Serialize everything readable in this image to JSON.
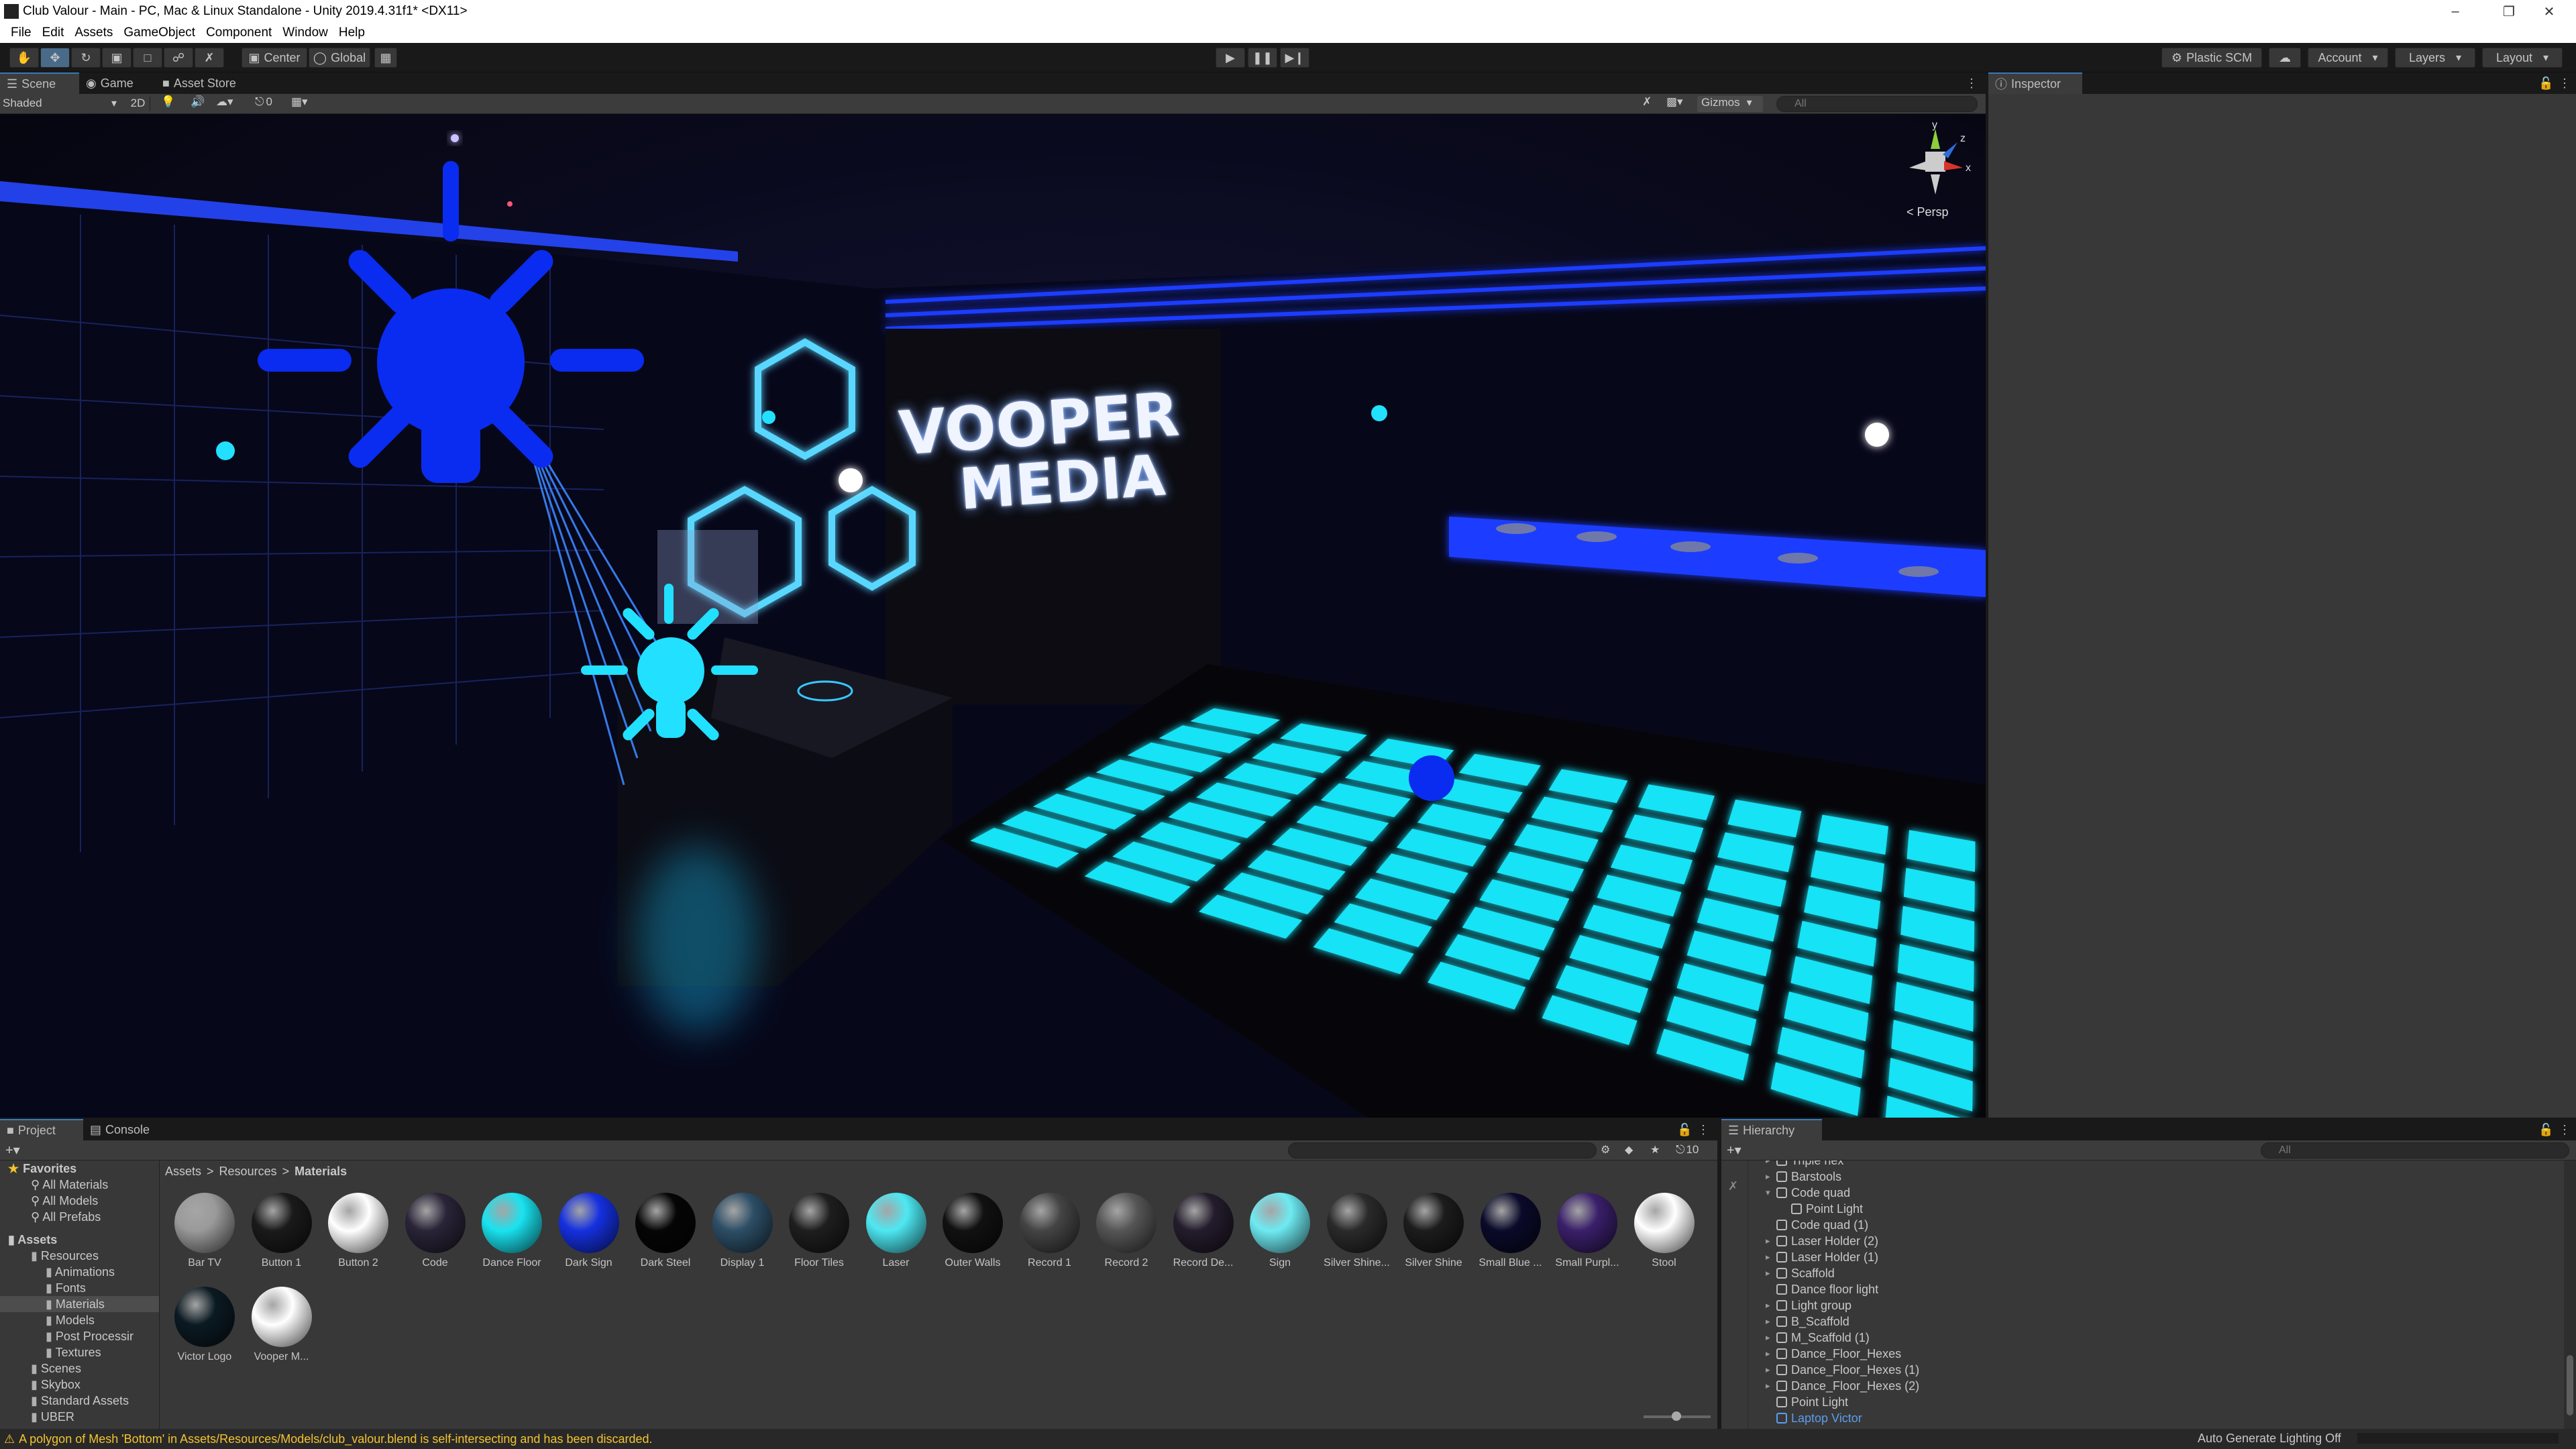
{
  "window": {
    "title": "Club Valour - Main - PC, Mac & Linux Standalone - Unity 2019.4.31f1* <DX11>"
  },
  "menu": [
    "File",
    "Edit",
    "Assets",
    "GameObject",
    "Component",
    "Window",
    "Help"
  ],
  "toolbar": {
    "pivot_label": "Center",
    "space_label": "Global",
    "plastic_label": "Plastic SCM",
    "account_label": "Account",
    "layers_label": "Layers",
    "layout_label": "Layout"
  },
  "scene_tabs": [
    "Scene",
    "Game",
    "Asset Store"
  ],
  "scene_bar": {
    "shading": "Shaded",
    "mode_2d": "2D",
    "hidden_count": "0",
    "gizmos_label": "Gizmos",
    "search_placeholder": "All"
  },
  "scene": {
    "sign_line1": "VOOPER",
    "sign_line2": "MEDIA",
    "persp_label": "< Persp",
    "axis_y": "y",
    "axis_x": "x",
    "axis_z": "z"
  },
  "inspector": {
    "tab_label": "Inspector"
  },
  "project": {
    "tabs": [
      "Project",
      "Console"
    ],
    "breadcrumb": [
      "Assets",
      "Resources",
      "Materials"
    ],
    "visible_count": "10",
    "favorites_label": "Favorites",
    "favorites": [
      "All Materials",
      "All Models",
      "All Prefabs"
    ],
    "assets_label": "Assets",
    "folders": [
      {
        "label": "Resources",
        "depth": 1
      },
      {
        "label": "Animations",
        "depth": 2
      },
      {
        "label": "Fonts",
        "depth": 2
      },
      {
        "label": "Materials",
        "depth": 2
      },
      {
        "label": "Models",
        "depth": 2
      },
      {
        "label": "Post Processir",
        "depth": 2
      },
      {
        "label": "Textures",
        "depth": 2
      },
      {
        "label": "Scenes",
        "depth": 1
      },
      {
        "label": "Skybox",
        "depth": 1
      },
      {
        "label": "Standard Assets",
        "depth": 1
      },
      {
        "label": "UBER",
        "depth": 1
      }
    ],
    "materials": [
      {
        "label": "Bar TV",
        "color": "#9a9a9a"
      },
      {
        "label": "Button 1",
        "color": "#1a1a1a"
      },
      {
        "label": "Button 2",
        "color": "#ffffff"
      },
      {
        "label": "Code",
        "color": "#2a2438"
      },
      {
        "label": "Dance Floor",
        "color": "#19e3f0"
      },
      {
        "label": "Dark Sign",
        "color": "#1530e0"
      },
      {
        "label": "Dark Steel",
        "color": "#050505"
      },
      {
        "label": "Display 1",
        "color": "#2c4e66"
      },
      {
        "label": "Floor Tiles",
        "color": "#1e1e1e"
      },
      {
        "label": "Laser",
        "color": "#4de8f2"
      },
      {
        "label": "Outer Walls",
        "color": "#111111"
      },
      {
        "label": "Record 1",
        "color": "#444444"
      },
      {
        "label": "Record 2",
        "color": "#555555"
      },
      {
        "label": "Record De...",
        "color": "#241c2c"
      },
      {
        "label": "Sign",
        "color": "#6eeaf2"
      },
      {
        "label": "Silver Shine...",
        "color": "#2a2a2a"
      },
      {
        "label": "Silver Shine",
        "color": "#1c1c1c"
      },
      {
        "label": "Small Blue ...",
        "color": "#0a0a2a"
      },
      {
        "label": "Small Purpl...",
        "color": "#3a1f6a"
      },
      {
        "label": "Stool",
        "color": "#ffffff"
      },
      {
        "label": "Victor Logo",
        "color": "#0b1a22"
      },
      {
        "label": "Vooper M...",
        "color": "#ffffff"
      }
    ]
  },
  "hierarchy": {
    "tab_label": "Hierarchy",
    "search_placeholder": "All",
    "items": [
      {
        "label": "Triple hex",
        "indent": 1,
        "arrow": true
      },
      {
        "label": "Barstools",
        "indent": 1,
        "arrow": true
      },
      {
        "label": "Code quad",
        "indent": 1,
        "arrow": true,
        "open": true
      },
      {
        "label": "Point Light",
        "indent": 2,
        "arrow": false
      },
      {
        "label": "Code quad (1)",
        "indent": 1,
        "arrow": false
      },
      {
        "label": "Laser Holder (2)",
        "indent": 1,
        "arrow": true
      },
      {
        "label": "Laser Holder (1)",
        "indent": 1,
        "arrow": true
      },
      {
        "label": "Scaffold",
        "indent": 1,
        "arrow": true
      },
      {
        "label": "Dance floor light",
        "indent": 1,
        "arrow": false
      },
      {
        "label": "Light group",
        "indent": 1,
        "arrow": true
      },
      {
        "label": "B_Scaffold",
        "indent": 1,
        "arrow": true
      },
      {
        "label": "M_Scaffold (1)",
        "indent": 1,
        "arrow": true
      },
      {
        "label": "Dance_Floor_Hexes",
        "indent": 1,
        "arrow": true
      },
      {
        "label": "Dance_Floor_Hexes (1)",
        "indent": 1,
        "arrow": true
      },
      {
        "label": "Dance_Floor_Hexes (2)",
        "indent": 1,
        "arrow": true
      },
      {
        "label": "Point Light",
        "indent": 1,
        "arrow": false
      },
      {
        "label": "Laptop Victor",
        "indent": 1,
        "arrow": false,
        "highlight": true
      }
    ]
  },
  "status": {
    "message": "A polygon of Mesh 'Bottom' in Assets/Resources/Models/club_valour.blend is self-intersecting and has been discarded.",
    "lighting": "Auto Generate Lighting Off"
  },
  "colors": {
    "accent": "#3a79bb",
    "glow_cyan": "#1ee6f5",
    "glow_blue": "#0a2cf0",
    "warning": "#f4c430"
  }
}
